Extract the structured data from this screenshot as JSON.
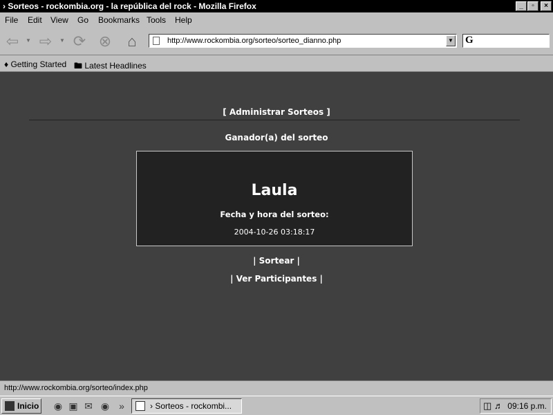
{
  "window": {
    "title": "› Sorteos - rockombia.org - la república del rock - Mozilla Firefox",
    "controls": {
      "minimize": "_",
      "maximize": "▫",
      "close": "×"
    }
  },
  "menu": [
    "File",
    "Edit",
    "View",
    "Go",
    "Bookmarks",
    "Tools",
    "Help"
  ],
  "toolbar": {
    "url": "http://www.rockombia.org/sorteo/sorteo_dianno.php",
    "search_engine_glyph": "G",
    "icons": [
      "back-icon",
      "forward-icon",
      "reload-icon",
      "stop-icon",
      "home-icon"
    ]
  },
  "bookmarks": [
    {
      "label": "Getting Started",
      "icon": "firefox-icon"
    },
    {
      "label": "Latest Headlines",
      "icon": "folder-icon"
    }
  ],
  "page": {
    "admin_link": "[ Administrar Sorteos ]",
    "winner_heading": "Ganador(a) del sorteo",
    "winner_name": "Laula",
    "date_label": "Fecha y hora del sorteo:",
    "date_value": "2004-10-26 03:18:17",
    "sortear_link": "| Sortear |",
    "participants_link": "| Ver Participantes |"
  },
  "status": {
    "text": "http://www.rockombia.org/sorteo/index.php"
  },
  "taskbar": {
    "start_label": "Inicio",
    "quicklaunch_more": "»",
    "task_label": "› Sorteos - rockombi...",
    "clock": "09:16 p.m."
  },
  "colors": {
    "page_background": "#404040",
    "box_background": "#222222",
    "chrome": "#c0c0c0",
    "titlebar": "#000000"
  }
}
